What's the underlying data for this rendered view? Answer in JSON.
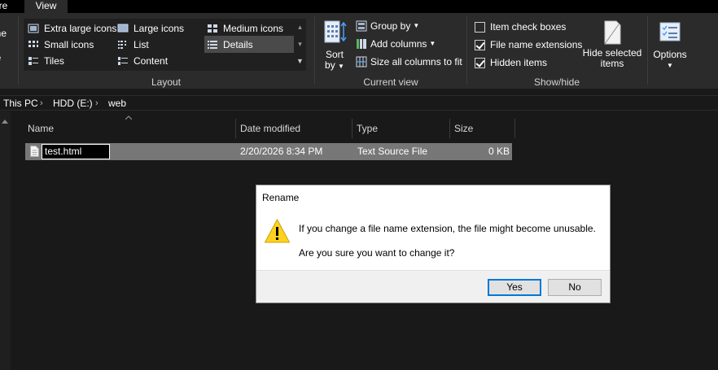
{
  "tabs": {
    "share": "are",
    "view": "View"
  },
  "ribbon": {
    "pane_cut": [
      "ane",
      "ne"
    ],
    "layout": {
      "items": [
        {
          "label": "Extra large icons",
          "icon": "extra-large-icons-icon",
          "selected": false
        },
        {
          "label": "Large icons",
          "icon": "large-icons-icon",
          "selected": false
        },
        {
          "label": "Medium icons",
          "icon": "medium-icons-icon",
          "selected": false
        },
        {
          "label": "Small icons",
          "icon": "small-icons-icon",
          "selected": false
        },
        {
          "label": "List",
          "icon": "list-icon",
          "selected": false
        },
        {
          "label": "Details",
          "icon": "details-icon",
          "selected": true
        },
        {
          "label": "Tiles",
          "icon": "tiles-icon",
          "selected": false
        },
        {
          "label": "Content",
          "icon": "content-icon",
          "selected": false
        }
      ],
      "group_label": "Layout"
    },
    "current_view": {
      "sort_by": "Sort by",
      "sort_line1": "Sort",
      "sort_line2": "by",
      "group_by": "Group by",
      "add_columns": "Add columns",
      "size_all_columns": "Size all columns to fit",
      "group_label": "Current view"
    },
    "show_hide": {
      "item_check_boxes": {
        "label": "Item check boxes",
        "checked": false
      },
      "file_name_extensions": {
        "label": "File name extensions",
        "checked": true
      },
      "hidden_items": {
        "label": "Hidden items",
        "checked": true
      },
      "hide_selected_line1": "Hide selected",
      "hide_selected_line2": "items",
      "group_label": "Show/hide"
    },
    "options": {
      "label": "Options"
    }
  },
  "address": {
    "crumbs": [
      "This PC",
      "HDD (E:)",
      "web"
    ]
  },
  "list": {
    "columns": [
      "Name",
      "Date modified",
      "Type",
      "Size"
    ],
    "rows": [
      {
        "name": "test.html",
        "date_modified": "2/20/2026 8:34 PM",
        "type": "Text Source File",
        "size": "0 KB"
      }
    ]
  },
  "dialog": {
    "title": "Rename",
    "message": "If you change a file name extension, the file might become unusable.",
    "question": "Are you sure you want to change it?",
    "yes": "Yes",
    "no": "No"
  },
  "colors": {
    "ribbon_bg": "#2b2b2b",
    "window_bg": "#191919",
    "selection": "#777777",
    "accent": "#0078d7",
    "warning": "#ffd21f"
  }
}
